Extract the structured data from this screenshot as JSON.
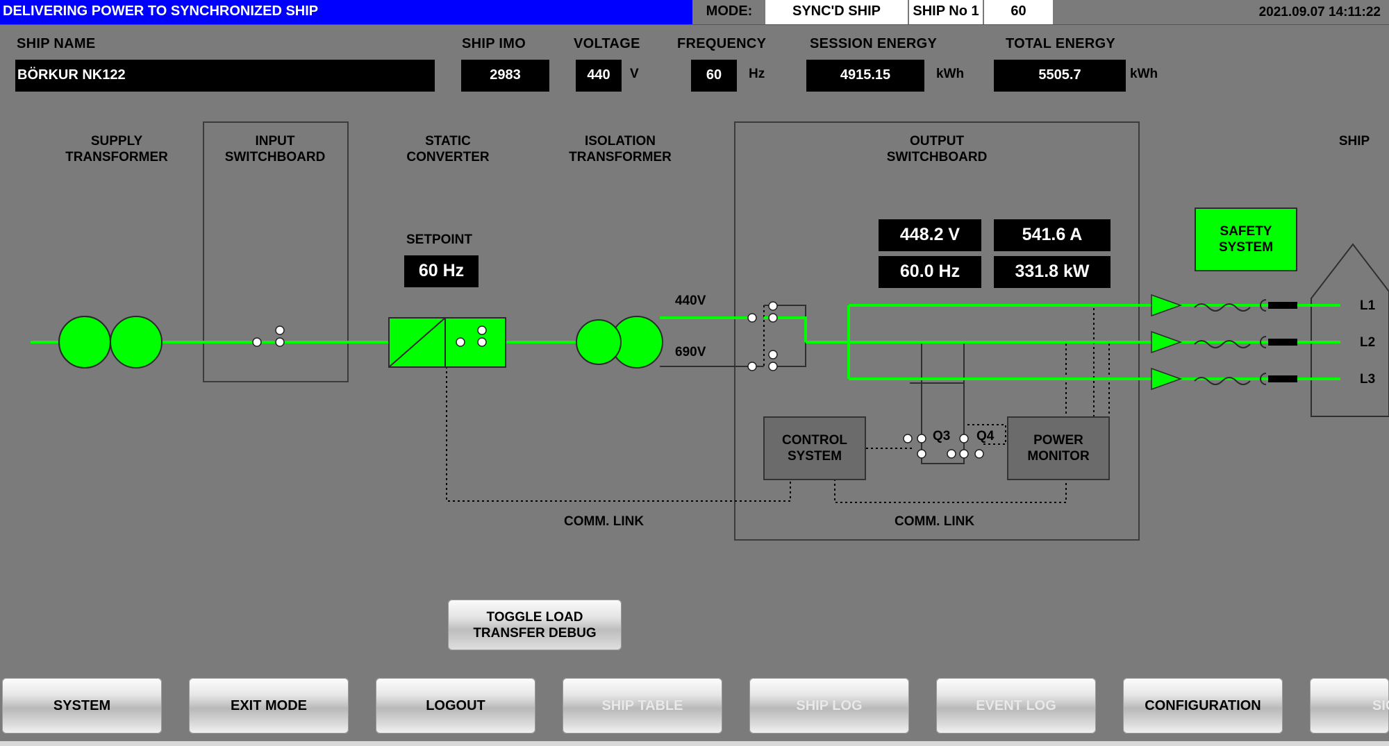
{
  "header": {
    "status": "DELIVERING POWER TO SYNCHRONIZED SHIP",
    "mode_label": "MODE:",
    "mode_value": "SYNC'D SHIP",
    "ship_no": "SHIP No 1",
    "freq_value": "60",
    "datetime": "2021.09.07 14:11:22"
  },
  "info": {
    "ship_name_label": "SHIP NAME",
    "ship_name": "BÖRKUR NK122",
    "imo_label": "SHIP IMO",
    "imo": "2983",
    "voltage_label": "VOLTAGE",
    "voltage": "440",
    "voltage_unit": "V",
    "frequency_label": "FREQUENCY",
    "frequency": "60",
    "frequency_unit": "Hz",
    "session_energy_label": "SESSION ENERGY",
    "session_energy": "4915.15",
    "session_energy_unit": "kWh",
    "total_energy_label": "TOTAL ENERGY",
    "total_energy": "5505.7",
    "total_energy_unit": "kWh"
  },
  "diagram": {
    "supply_transformer": [
      "SUPPLY",
      "TRANSFORMER"
    ],
    "input_switchboard": [
      "INPUT",
      "SWITCHBOARD"
    ],
    "static_converter": [
      "STATIC",
      "CONVERTER"
    ],
    "isolation_transformer": [
      "ISOLATION",
      "TRANSFORMER"
    ],
    "output_switchboard": [
      "OUTPUT",
      "SWITCHBOARD"
    ],
    "ship": "SHIP",
    "setpoint_label": "SETPOINT",
    "setpoint_value": "60 Hz",
    "tap_440": "440V",
    "tap_690": "690V",
    "readout_voltage": "448.2 V",
    "readout_current": "541.6 A",
    "readout_freq": "60.0 Hz",
    "readout_power": "331.8 kW",
    "safety_system": [
      "SAFETY",
      "SYSTEM"
    ],
    "control_system": [
      "CONTROL",
      "SYSTEM"
    ],
    "power_monitor": [
      "POWER",
      "MONITOR"
    ],
    "q3": "Q3",
    "q4": "Q4",
    "comm_link_1": "COMM. LINK",
    "comm_link_2": "COMM. LINK",
    "l1": "L1",
    "l2": "L2",
    "l3": "L3"
  },
  "toggle_debug": [
    "TOGGLE LOAD",
    "TRANSFER DEBUG"
  ],
  "nav": {
    "system": "SYSTEM",
    "exit_mode": "EXIT MODE",
    "logout": "LOGOUT",
    "ship_table": "SHIP TABLE",
    "ship_log": "SHIP LOG",
    "event_log": "EVENT LOG",
    "configuration": "CONFIGURATION",
    "sign": "SIGN"
  },
  "colors": {
    "status_bar": "#0000ff",
    "energized": "#00ff00",
    "background": "#7b7b7b"
  }
}
